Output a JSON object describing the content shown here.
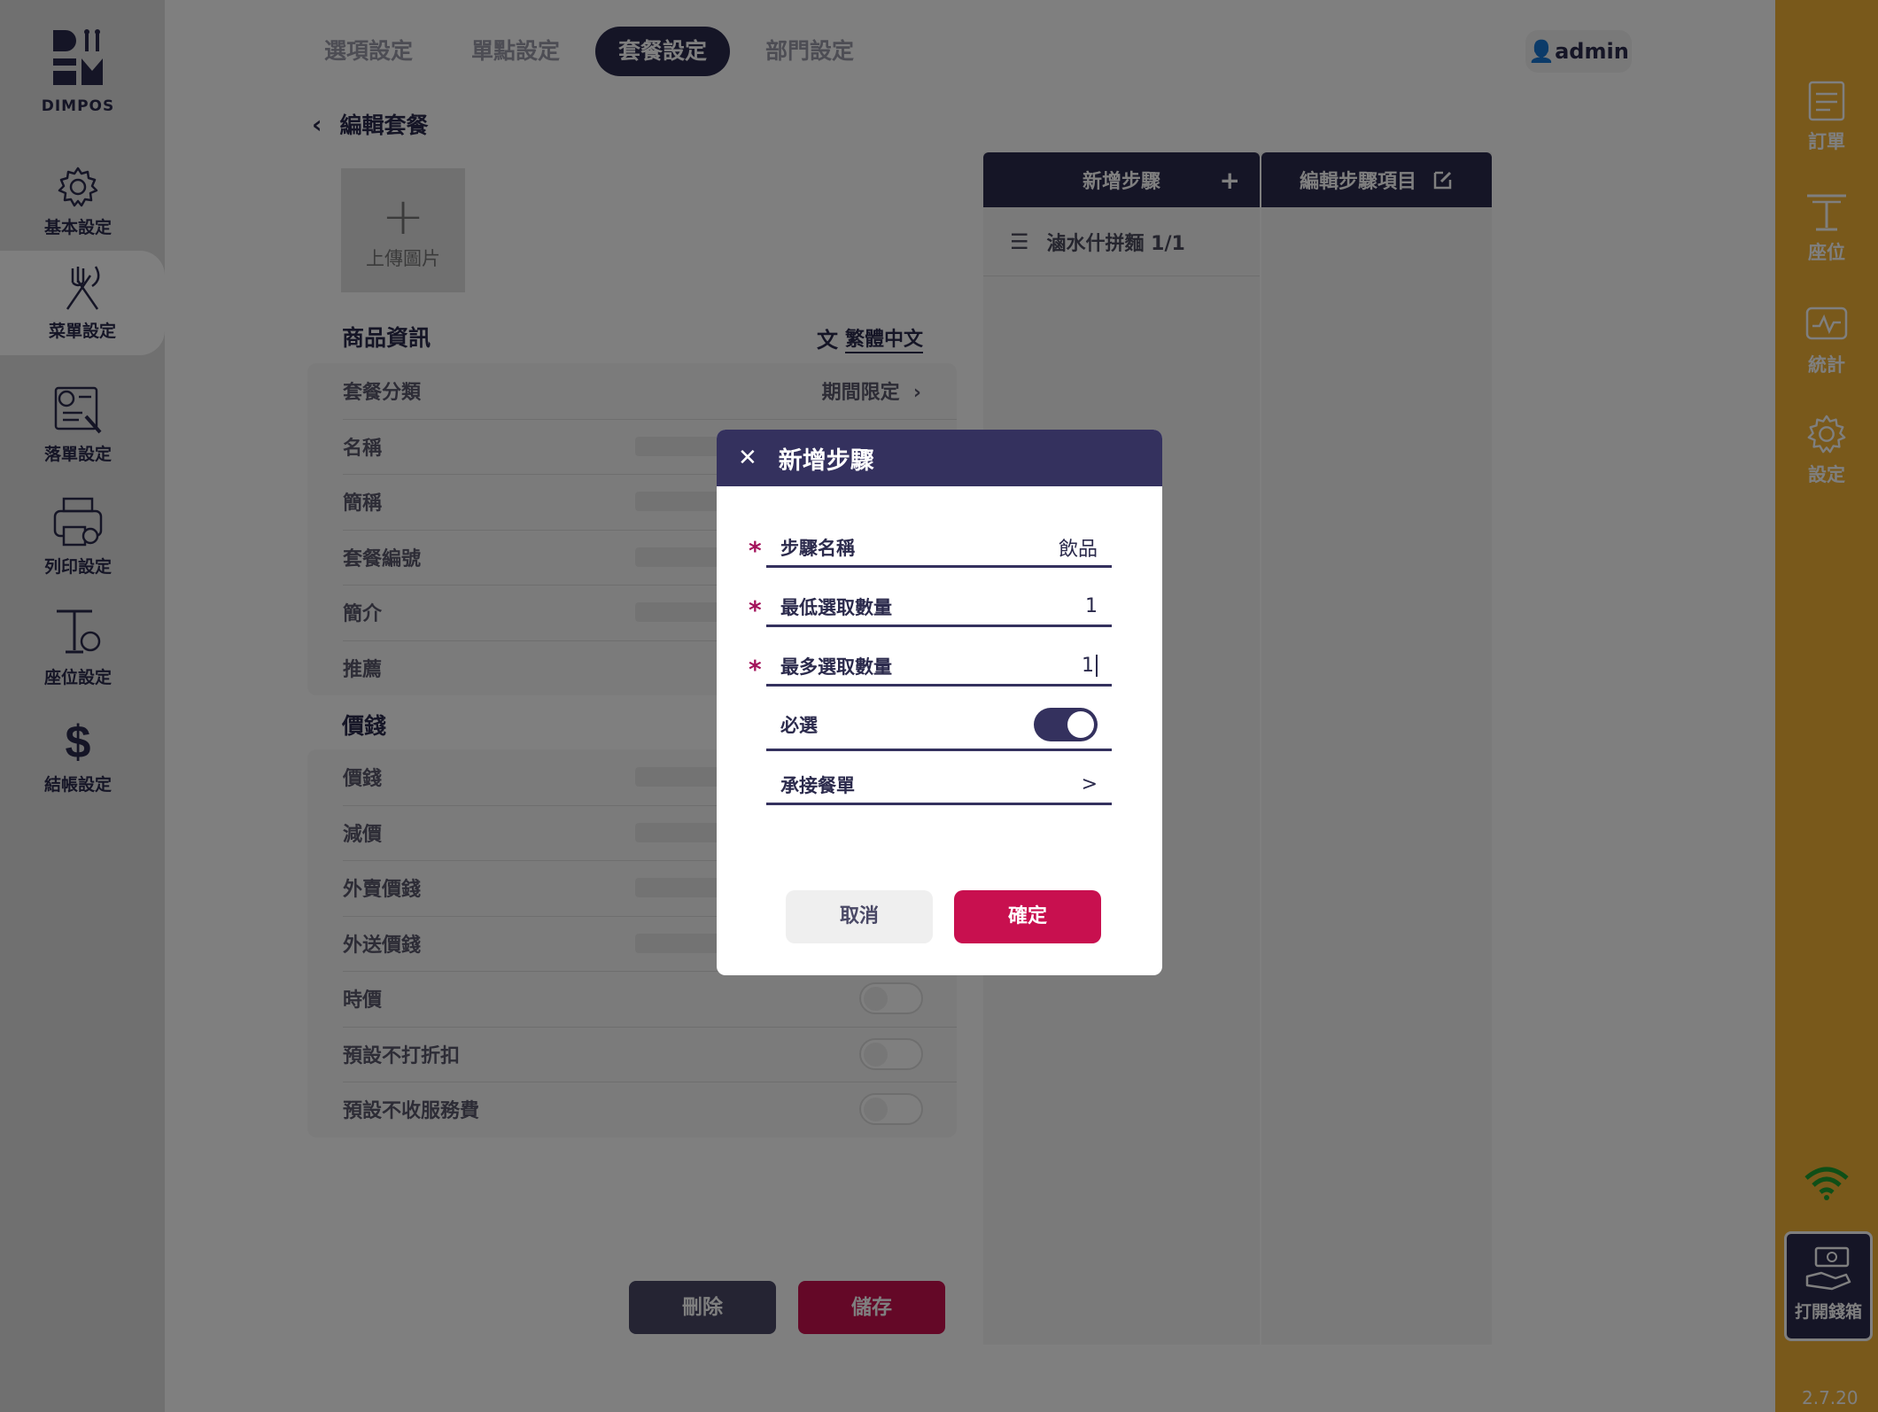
{
  "app": {
    "logo_text": "DIMPOS",
    "version": "2.7.20"
  },
  "sidebar": {
    "items": [
      {
        "label": "基本設定",
        "icon": "gear-icon"
      },
      {
        "label": "菜單設定",
        "icon": "fork-knife-icon"
      },
      {
        "label": "落單設定",
        "icon": "order-settings-icon"
      },
      {
        "label": "列印設定",
        "icon": "printer-icon"
      },
      {
        "label": "座位設定",
        "icon": "table-settings-icon"
      },
      {
        "label": "結帳設定",
        "icon": "dollar-icon"
      }
    ]
  },
  "tabs": [
    {
      "label": "選項設定"
    },
    {
      "label": "單點設定"
    },
    {
      "label": "套餐設定"
    },
    {
      "label": "部門設定"
    }
  ],
  "user": {
    "name": "admin"
  },
  "edit": {
    "title": "編輯套餐",
    "upload_label": "上傳圖片",
    "product_info_title": "商品資訊",
    "language": "繁體中文",
    "info_rows": [
      {
        "label": "套餐分類",
        "value": "期間限定"
      },
      {
        "label": "名稱"
      },
      {
        "label": "簡稱"
      },
      {
        "label": "套餐編號"
      },
      {
        "label": "簡介"
      },
      {
        "label": "推薦"
      }
    ],
    "price_title": "價錢",
    "price_rows": [
      {
        "label": "價錢"
      },
      {
        "label": "減價"
      },
      {
        "label": "外賣價錢"
      },
      {
        "label": "外送價錢"
      },
      {
        "label": "時價"
      },
      {
        "label": "預設不打折扣"
      },
      {
        "label": "預設不收服務費"
      }
    ],
    "delete_label": "刪除",
    "save_label": "儲存"
  },
  "steps": {
    "add_step_label": "新增步驟",
    "edit_items_label": "編輯步驟項目",
    "list": [
      {
        "label": "滷水什拼麵 1/1"
      }
    ]
  },
  "rightbar": {
    "items": [
      {
        "label": "訂單",
        "icon": "order-icon"
      },
      {
        "label": "座位",
        "icon": "seat-icon"
      },
      {
        "label": "統計",
        "icon": "stats-icon"
      },
      {
        "label": "設定",
        "icon": "settings-icon"
      }
    ],
    "cashbox_label": "打開錢箱"
  },
  "modal": {
    "title": "新增步驟",
    "fields": {
      "step_name": {
        "label": "步驟名稱",
        "value": "飲品"
      },
      "min_select": {
        "label": "最低選取數量",
        "value": "1"
      },
      "max_select": {
        "label": "最多選取數量",
        "value": "1"
      },
      "required": {
        "label": "必選",
        "on": true
      },
      "next_menu": {
        "label": "承接餐單",
        "value": ">"
      }
    },
    "required_mark": "*",
    "cancel_label": "取消",
    "confirm_label": "確定"
  },
  "colors": {
    "primary": "#2b2a4c",
    "modal_header": "#34315e",
    "accent": "#c8104f",
    "rightbar": "#f2b236",
    "wifi": "#1e9e2e"
  }
}
